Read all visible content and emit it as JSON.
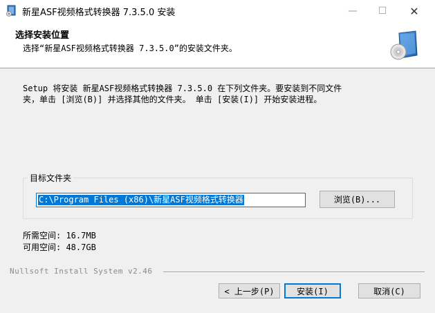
{
  "window": {
    "title": "新星ASF视频格式转换器 7.3.5.0 安装",
    "min_glyph": "—",
    "max_glyph": "☐",
    "close_glyph": "✕"
  },
  "header": {
    "title": "选择安装位置",
    "subtitle": "选择“新星ASF视频格式转换器 7.3.5.0”的安装文件夹。"
  },
  "body": {
    "intro": "Setup 将安装 新星ASF视频格式转换器 7.3.5.0 在下列文件夹。要安装到不同文件\n夹，单击 [浏览(B)] 并选择其他的文件夹。 单击 [安装(I)] 开始安装进程。",
    "group_label": "目标文件夹",
    "path_value": "C:\\Program Files (x86)\\新星ASF视频格式转换器",
    "browse_label": "浏览(B)...",
    "space_required": "所需空间: 16.7MB",
    "space_available": "可用空间: 48.7GB"
  },
  "footer": {
    "brand": "Nullsoft Install System v2.46",
    "back_label": "< 上一步(P)",
    "install_label": "安装(I)",
    "cancel_label": "取消(C)"
  },
  "colors": {
    "accent": "#0078d7",
    "body_bg": "#f0f0f0"
  },
  "icons": [
    "installer-app-icon",
    "cd-installer-logo-icon"
  ]
}
